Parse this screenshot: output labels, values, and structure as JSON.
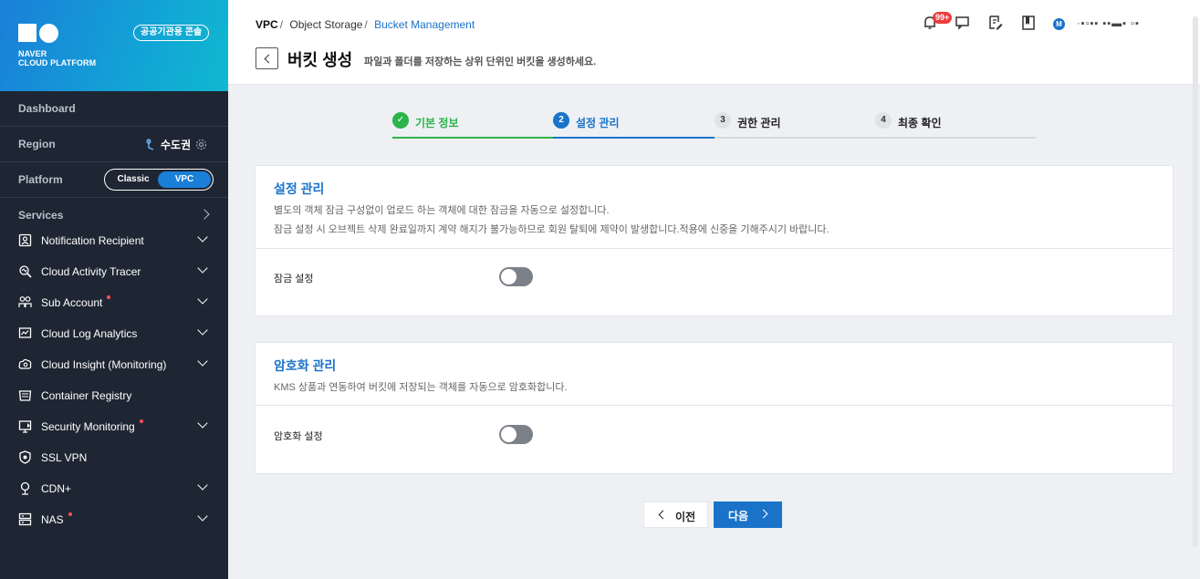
{
  "brand": {
    "line1": "NAVER",
    "line2": "CLOUD PLATFORM",
    "gov_badge": "공공기관용 콘솔"
  },
  "sidebar": {
    "dashboard": "Dashboard",
    "region_label": "Region",
    "region_value": "수도권",
    "platform_label": "Platform",
    "platform_classic": "Classic",
    "platform_vpc": "VPC",
    "services_label": "Services",
    "items": [
      {
        "label": "Notification Recipient",
        "icon": "contact-card-icon",
        "dot": false,
        "expandable": true
      },
      {
        "label": "Cloud Activity Tracer",
        "icon": "activity-tracer-icon",
        "dot": false,
        "expandable": true
      },
      {
        "label": "Sub Account",
        "icon": "users-icon",
        "dot": true,
        "expandable": true
      },
      {
        "label": "Cloud Log Analytics",
        "icon": "log-analytics-icon",
        "dot": false,
        "expandable": true
      },
      {
        "label": "Cloud Insight (Monitoring)",
        "icon": "monitoring-icon",
        "dot": false,
        "expandable": true
      },
      {
        "label": "Container Registry",
        "icon": "container-registry-icon",
        "dot": false,
        "expandable": false
      },
      {
        "label": "Security Monitoring",
        "icon": "security-monitoring-icon",
        "dot": true,
        "expandable": true
      },
      {
        "label": "SSL VPN",
        "icon": "ssl-vpn-icon",
        "dot": false,
        "expandable": false
      },
      {
        "label": "CDN+",
        "icon": "cdn-icon",
        "dot": false,
        "expandable": true
      },
      {
        "label": "NAS",
        "icon": "nas-icon",
        "dot": true,
        "expandable": true
      }
    ]
  },
  "header": {
    "breadcrumb": [
      "VPC",
      "Object Storage",
      "Bucket Management"
    ],
    "title": "버킷 생성",
    "description": "파일과 폴더를 저장하는 상위 단위인 버킷을 생성하세요.",
    "notification_count": "99+",
    "avatar_initial": "M",
    "user_name": "·▪▫▪▪ ▪▪▬▪ ▫▪"
  },
  "steps": [
    {
      "num": "✓",
      "label": "기본 정보",
      "state": "done"
    },
    {
      "num": "2",
      "label": "설정 관리",
      "state": "current"
    },
    {
      "num": "3",
      "label": "권한 관리",
      "state": "todo"
    },
    {
      "num": "4",
      "label": "최종 확인",
      "state": "todo"
    }
  ],
  "lock_panel": {
    "title": "설정 관리",
    "desc1": "별도의 객체 잠금 구성없이 업로드 하는 객체에 대한 잠금을 자동으로 설정합니다.",
    "desc2": "잠금 설정 시 오브젝트 삭제 완료일까지 계약 해지가 불가능하므로 회원 탈퇴에 제약이 발생합니다.적용에 신중을 기해주시기 바랍니다.",
    "field_label": "잠금 설정",
    "enabled": false
  },
  "encrypt_panel": {
    "title": "암호화 관리",
    "desc1": "KMS 상품과 연동하여 버킷에 저장되는 객체를 자동으로 암호화합니다.",
    "field_label": "암호화 설정",
    "enabled": false
  },
  "buttons": {
    "prev": "이전",
    "next": "다음"
  },
  "colors": {
    "accent": "#1a73c9",
    "done": "#2cb34a",
    "sidebar_bg": "#1e2633"
  }
}
